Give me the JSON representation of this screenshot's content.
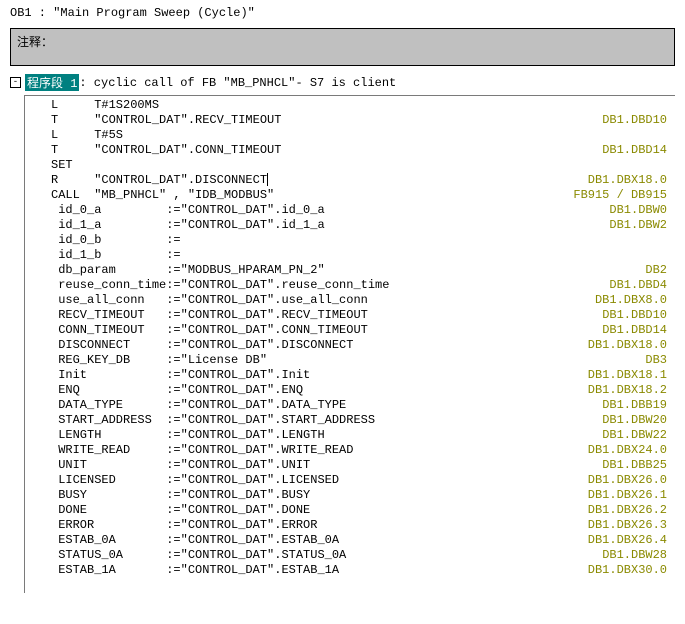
{
  "ob_title": "OB1 : \"Main Program Sweep (Cycle)\"",
  "comment_label": "注释：",
  "network": {
    "toggle": "-",
    "label": "程序段 1",
    "desc": ": cyclic call of FB \"MB_PNHCL\"- S7 is client"
  },
  "code_lines": [
    {
      "left": "L     T#1S200MS",
      "right": ""
    },
    {
      "left": "T     \"CONTROL_DAT\".RECV_TIMEOUT",
      "right": "DB1.DBD10"
    },
    {
      "left": "L     T#5S",
      "right": ""
    },
    {
      "left": "T     \"CONTROL_DAT\".CONN_TIMEOUT",
      "right": "DB1.DBD14"
    },
    {
      "left": "SET   ",
      "right": ""
    },
    {
      "left": "R     \"CONTROL_DAT\".DISCONNECT",
      "right": "DB1.DBX18.0",
      "cursor": true
    },
    {
      "left": "CALL  \"MB_PNHCL\" , \"IDB_MODBUS\"",
      "right": "FB915 / DB915"
    },
    {
      "left": " id_0_a         :=\"CONTROL_DAT\".id_0_a",
      "right": "DB1.DBW0"
    },
    {
      "left": " id_1_a         :=\"CONTROL_DAT\".id_1_a",
      "right": "DB1.DBW2"
    },
    {
      "left": " id_0_b         :=",
      "right": ""
    },
    {
      "left": " id_1_b         :=",
      "right": ""
    },
    {
      "left": " db_param       :=\"MODBUS_HPARAM_PN_2\"",
      "right": "DB2"
    },
    {
      "left": " reuse_conn_time:=\"CONTROL_DAT\".reuse_conn_time",
      "right": "DB1.DBD4"
    },
    {
      "left": " use_all_conn   :=\"CONTROL_DAT\".use_all_conn",
      "right": "DB1.DBX8.0"
    },
    {
      "left": " RECV_TIMEOUT   :=\"CONTROL_DAT\".RECV_TIMEOUT",
      "right": "DB1.DBD10"
    },
    {
      "left": " CONN_TIMEOUT   :=\"CONTROL_DAT\".CONN_TIMEOUT",
      "right": "DB1.DBD14"
    },
    {
      "left": " DISCONNECT     :=\"CONTROL_DAT\".DISCONNECT",
      "right": "DB1.DBX18.0"
    },
    {
      "left": " REG_KEY_DB     :=\"License DB\"",
      "right": "DB3"
    },
    {
      "left": " Init           :=\"CONTROL_DAT\".Init",
      "right": "DB1.DBX18.1"
    },
    {
      "left": " ENQ            :=\"CONTROL_DAT\".ENQ",
      "right": "DB1.DBX18.2"
    },
    {
      "left": " DATA_TYPE      :=\"CONTROL_DAT\".DATA_TYPE",
      "right": "DB1.DBB19"
    },
    {
      "left": " START_ADDRESS  :=\"CONTROL_DAT\".START_ADDRESS",
      "right": "DB1.DBW20"
    },
    {
      "left": " LENGTH         :=\"CONTROL_DAT\".LENGTH",
      "right": "DB1.DBW22"
    },
    {
      "left": " WRITE_READ     :=\"CONTROL_DAT\".WRITE_READ",
      "right": "DB1.DBX24.0"
    },
    {
      "left": " UNIT           :=\"CONTROL_DAT\".UNIT",
      "right": "DB1.DBB25"
    },
    {
      "left": " LICENSED       :=\"CONTROL_DAT\".LICENSED",
      "right": "DB1.DBX26.0"
    },
    {
      "left": " BUSY           :=\"CONTROL_DAT\".BUSY",
      "right": "DB1.DBX26.1"
    },
    {
      "left": " DONE           :=\"CONTROL_DAT\".DONE",
      "right": "DB1.DBX26.2"
    },
    {
      "left": " ERROR          :=\"CONTROL_DAT\".ERROR",
      "right": "DB1.DBX26.3"
    },
    {
      "left": " ESTAB_0A       :=\"CONTROL_DAT\".ESTAB_0A",
      "right": "DB1.DBX26.4"
    },
    {
      "left": " STATUS_0A      :=\"CONTROL_DAT\".STATUS_0A",
      "right": "DB1.DBW28"
    },
    {
      "left": " ESTAB_1A       :=\"CONTROL_DAT\".ESTAB_1A",
      "right": "DB1.DBX30.0"
    }
  ]
}
